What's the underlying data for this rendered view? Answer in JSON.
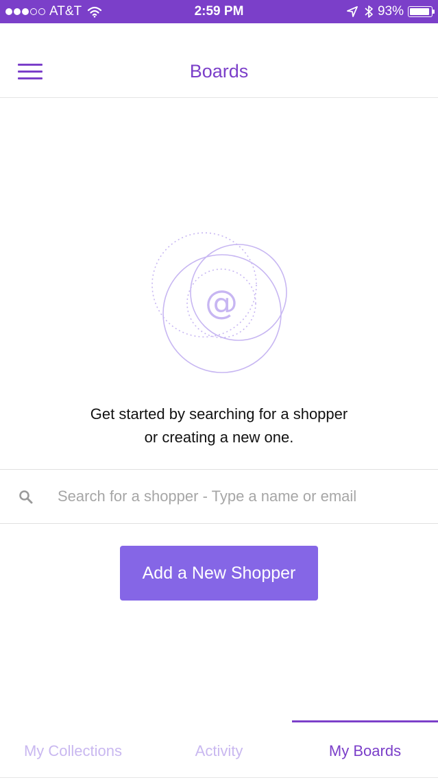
{
  "status_bar": {
    "carrier": "AT&T",
    "time": "2:59 PM",
    "battery": "93%",
    "signal_bars": 3,
    "signal_total": 5
  },
  "nav": {
    "title": "Boards",
    "menu_icon": "hamburger-menu-icon"
  },
  "empty_state": {
    "icon": "at-sign-icon",
    "glyph": "@",
    "line1": "Get started by searching for a shopper",
    "line2": "or creating a new one."
  },
  "search": {
    "placeholder": "Search for a shopper - Type a name or email",
    "value": ""
  },
  "add_button": {
    "label": "Add a New Shopper"
  },
  "tabs": [
    {
      "label": "My Collections",
      "active": false
    },
    {
      "label": "Activity",
      "active": false
    },
    {
      "label": "My Boards",
      "active": true
    }
  ],
  "colors": {
    "brand": "#7b3fc9",
    "button": "#8566e6",
    "tab_inactive": "#c9b8f0",
    "illustration": "#c7b6f2"
  }
}
